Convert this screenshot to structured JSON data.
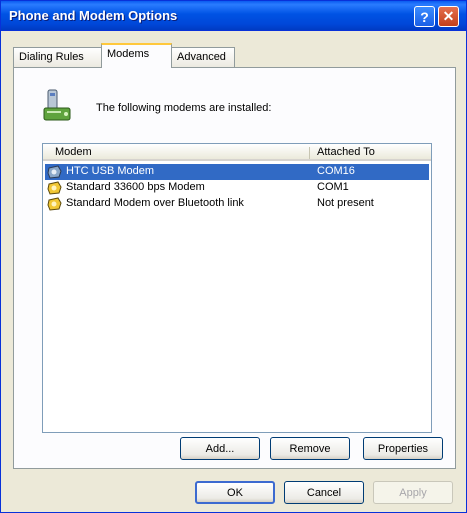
{
  "window": {
    "title": "Phone and Modem Options"
  },
  "titlebar": {
    "help_label": "?",
    "close_label": "✕"
  },
  "tabs": [
    {
      "label": "Dialing Rules"
    },
    {
      "label": "Modems",
      "selected": true
    },
    {
      "label": "Advanced"
    }
  ],
  "panel": {
    "installed_text": "The following modems are installed:"
  },
  "list": {
    "columns": {
      "modem": "Modem",
      "attached_to": "Attached To"
    },
    "rows": [
      {
        "name": "HTC USB Modem",
        "port": "COM16",
        "selected": true
      },
      {
        "name": "Standard 33600 bps Modem",
        "port": "COM1",
        "selected": false
      },
      {
        "name": "Standard Modem over Bluetooth link",
        "port": "Not present",
        "selected": false
      }
    ]
  },
  "panel_buttons": {
    "add": "Add...",
    "remove": "Remove",
    "properties": "Properties"
  },
  "dialog_buttons": {
    "ok": "OK",
    "cancel": "Cancel",
    "apply": "Apply"
  },
  "colors": {
    "titlebar": "#0053e4",
    "selection": "#316ac5",
    "dialog_bg": "#ece9d8"
  },
  "icons": {
    "modem_header": "modem-phone-icon",
    "modem_row": "modem-icon"
  }
}
